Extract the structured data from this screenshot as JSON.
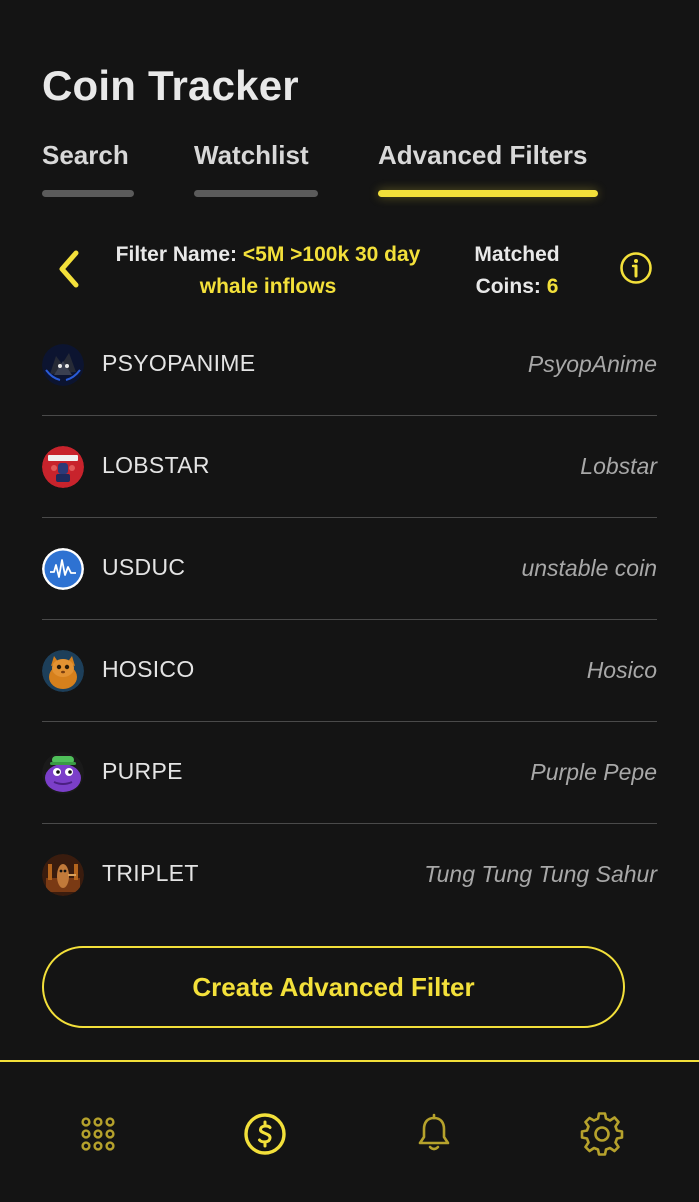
{
  "app": {
    "title": "Coin Tracker"
  },
  "tabs": [
    {
      "label": "Search",
      "active": false
    },
    {
      "label": "Watchlist",
      "active": false
    },
    {
      "label": "Advanced Filters",
      "active": true
    }
  ],
  "filter": {
    "name_label": "Filter Name:",
    "name_value": "<5M >100k 30 day whale inflows",
    "matched_label_1": "Matched",
    "matched_label_2": "Coins:",
    "matched_count": "6"
  },
  "coins": [
    {
      "symbol": "PSYOPANIME",
      "name": "PsyopAnime",
      "avatar_icon": "psyopanime-avatar"
    },
    {
      "symbol": "LOBSTAR",
      "name": "Lobstar",
      "avatar_icon": "lobstar-avatar"
    },
    {
      "symbol": "USDUC",
      "name": "unstable coin",
      "avatar_icon": "usduc-avatar"
    },
    {
      "symbol": "HOSICO",
      "name": "Hosico",
      "avatar_icon": "hosico-avatar"
    },
    {
      "symbol": "PURPE",
      "name": "Purple Pepe",
      "avatar_icon": "purpe-avatar"
    },
    {
      "symbol": "TRIPLET",
      "name": "Tung Tung Tung Sahur",
      "avatar_icon": "triplet-avatar"
    }
  ],
  "actions": {
    "create_label": "Create Advanced Filter"
  },
  "nav": [
    {
      "icon": "grid-icon",
      "active": false
    },
    {
      "icon": "coin-dollar-icon",
      "active": true
    },
    {
      "icon": "bell-icon",
      "active": false
    },
    {
      "icon": "gear-icon",
      "active": false
    }
  ],
  "colors": {
    "background": "#141414",
    "accent": "#f3e03a",
    "accent_dim": "#b6a22c",
    "text": "#e6e6e6",
    "muted": "#a8a8a8",
    "divider": "#4a4a4a"
  }
}
